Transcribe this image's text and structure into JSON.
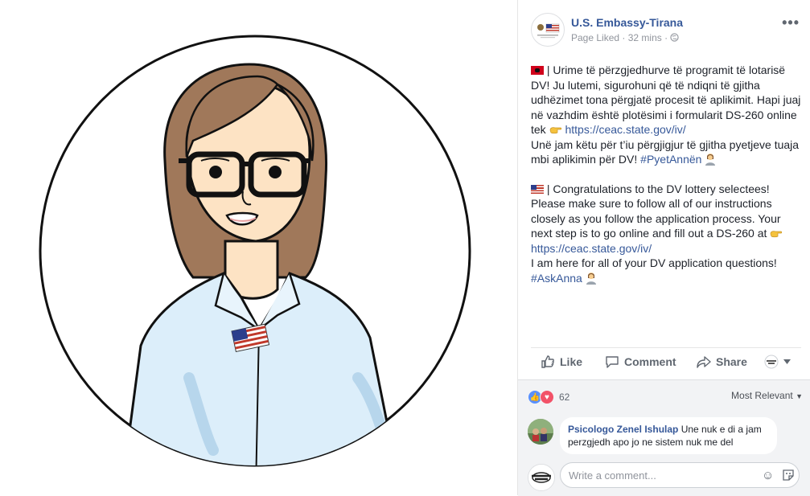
{
  "page": {
    "name": "U.S. Embassy-Tirana",
    "liked": "Page Liked",
    "dot": "·",
    "time": "32 mins",
    "more": "•••"
  },
  "post": {
    "al_text": " | Urime të përzgjedhurve të programit të lotarisë DV! Ju lutemi, sigurohuni që të ndiqni të gjitha udhëzimet tona përgjatë procesit të aplikimit. Hapi juaj në vazhdim është plotësimi i formularit DS-260 online tek ",
    "al_link": "https://ceac.state.gov/iv/",
    "al_line2": "Unë jam këtu për t’iu përgjigjur të gjitha pyetjeve tuaja mbi aplikimin për DV! ",
    "al_hashtag": "#PyetAnnën",
    "en_text": " | Congratulations to the DV lottery selectees! Please make sure to follow all of our instructions closely as you follow the application process. Your next step is to go online and fill out a DS-260 at ",
    "en_link": "https://ceac.state.gov/iv/",
    "en_line2": "I am here for all of your DV application questions! ",
    "en_hashtag": "#AskAnna"
  },
  "actions": {
    "like": "Like",
    "comment": "Comment",
    "share": "Share"
  },
  "reactions": {
    "count": "62",
    "sort": "Most Relevant"
  },
  "comment": {
    "author": "Psicologo Zenel Ishulap",
    "text": " Une nuk e di a jam perzgjedh apo jo ne sistem nuk me del"
  },
  "composer": {
    "placeholder": "Write a comment..."
  },
  "colors": {
    "link": "#365899",
    "hair": "#a0785a",
    "shirt": "#dceefa",
    "skin": "#fde3c4"
  },
  "icons": [
    "globe-icon",
    "like-icon",
    "comment-icon",
    "share-icon",
    "emoji-icon",
    "sticker-icon",
    "chevron-down-icon"
  ]
}
